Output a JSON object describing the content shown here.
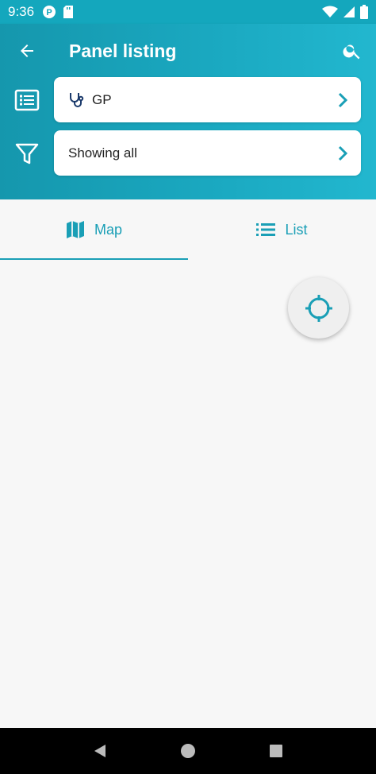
{
  "status_bar": {
    "time": "9:36"
  },
  "header": {
    "title": "Panel listing",
    "panel_selector": {
      "label": "GP"
    },
    "filter_selector": {
      "label": "Showing all"
    }
  },
  "tabs": [
    {
      "label": "Map",
      "active": true
    },
    {
      "label": "List",
      "active": false
    }
  ],
  "colors": {
    "accent": "#1a9fb6",
    "header_gradient_start": "#1597ad",
    "header_gradient_end": "#22b7cf",
    "icon_navy": "#1b3a6b"
  }
}
